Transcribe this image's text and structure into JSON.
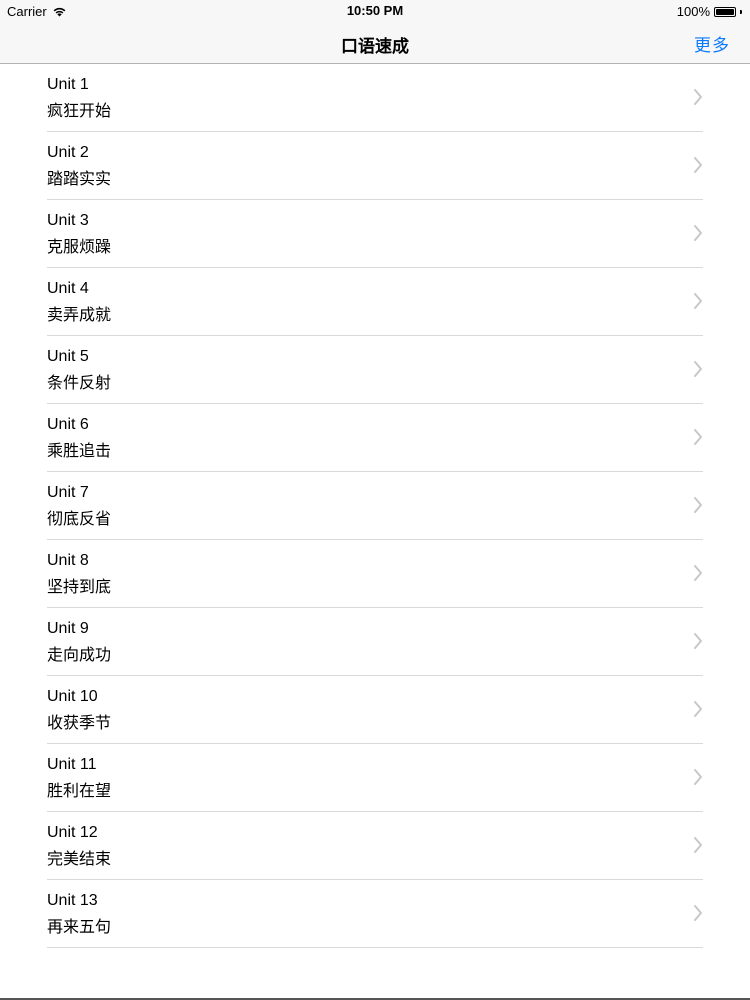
{
  "status_bar": {
    "carrier": "Carrier",
    "time": "10:50 PM",
    "battery": "100%",
    "battery_level": 1.0
  },
  "nav": {
    "title": "口语速成",
    "more_label": "更多"
  },
  "items": [
    {
      "title": "Unit 1",
      "subtitle": "疯狂开始"
    },
    {
      "title": "Unit 2",
      "subtitle": "踏踏实实"
    },
    {
      "title": "Unit 3",
      "subtitle": "克服烦躁"
    },
    {
      "title": "Unit 4",
      "subtitle": "卖弄成就"
    },
    {
      "title": "Unit 5",
      "subtitle": "条件反射"
    },
    {
      "title": "Unit 6",
      "subtitle": "乘胜追击"
    },
    {
      "title": "Unit 7",
      "subtitle": "彻底反省"
    },
    {
      "title": "Unit 8",
      "subtitle": "坚持到底"
    },
    {
      "title": "Unit 9",
      "subtitle": "走向成功"
    },
    {
      "title": "Unit 10",
      "subtitle": "收获季节"
    },
    {
      "title": "Unit 11",
      "subtitle": "胜利在望"
    },
    {
      "title": "Unit 12",
      "subtitle": "完美结束"
    },
    {
      "title": "Unit 13",
      "subtitle": "再来五句"
    }
  ],
  "colors": {
    "accent": "#0a7aff",
    "chevron": "#c7c7cc",
    "separator": "#d9d9d9"
  }
}
